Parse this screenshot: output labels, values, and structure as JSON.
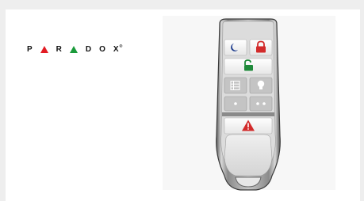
{
  "brand": {
    "letters": [
      "P",
      "R",
      "D",
      "O",
      "X"
    ],
    "registered": "®"
  },
  "colors": {
    "page_background": "#eeeeee",
    "frame_background": "#ffffff",
    "logo_red": "#e21b23",
    "logo_green": "#1a9a3a",
    "button_red": "#d22a2a",
    "button_green": "#1f8a3a",
    "button_blue": "#1b3a8c"
  },
  "remote": {
    "buttons": [
      {
        "name": "stay-arm",
        "icon": "moon-icon"
      },
      {
        "name": "full-arm",
        "icon": "lock-closed-icon"
      },
      {
        "name": "disarm",
        "icon": "lock-open-icon"
      },
      {
        "name": "aux-grid",
        "icon": "grid-icon"
      },
      {
        "name": "aux-light",
        "icon": "lightbulb-icon"
      },
      {
        "name": "aux-one-dot",
        "icon": "dot-icon"
      },
      {
        "name": "aux-two-dots",
        "icon": "two-dots-icon"
      },
      {
        "name": "panic",
        "icon": "warning-icon"
      }
    ]
  }
}
